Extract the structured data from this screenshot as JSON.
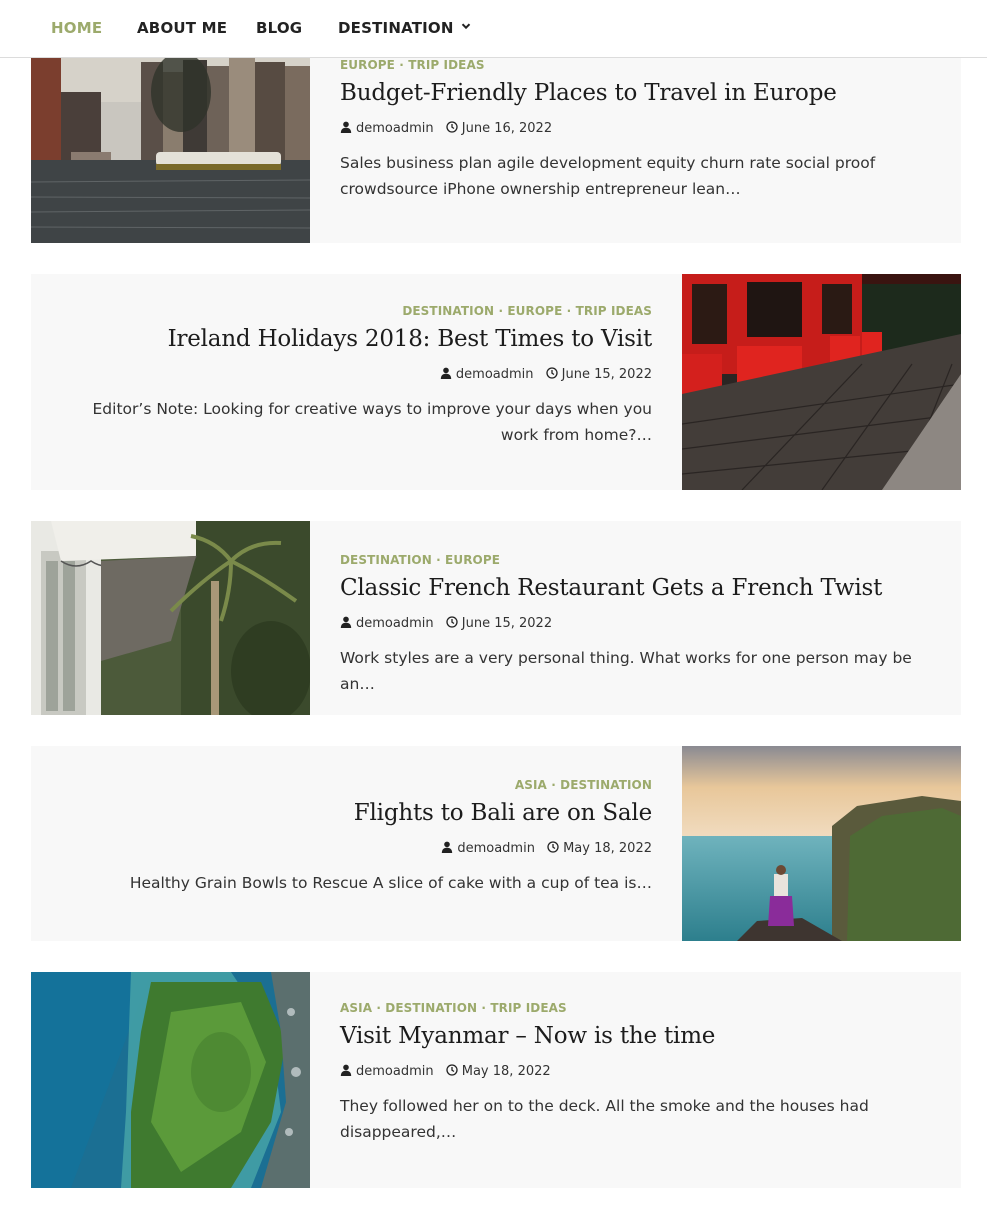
{
  "nav": {
    "items": [
      {
        "label": "HOME",
        "active": true
      },
      {
        "label": "ABOUT ME",
        "active": false
      },
      {
        "label": "BLOG",
        "active": false
      },
      {
        "label": "DESTINATION",
        "active": false,
        "has_dropdown": true
      }
    ],
    "active_color": "#9caa6c"
  },
  "posts": [
    {
      "categories": "EUROPE · TRIP IDEAS",
      "title": "Budget-Friendly Places to Travel in Europe",
      "author": "demoadmin",
      "date": "June 16, 2022",
      "excerpt": "Sales business plan agile development equity churn rate social proof crowdsource iPhone ownership entrepreneur lean…",
      "image": "amsterdam-canal"
    },
    {
      "categories": "DESTINATION · EUROPE · TRIP IDEAS",
      "title": "Ireland Holidays 2018: Best Times to Visit",
      "author": "demoadmin",
      "date": "June 15, 2022",
      "excerpt": "Editor’s Note: Looking for creative ways to improve your days when you work from home?…",
      "image": "red-pub-cobblestone"
    },
    {
      "categories": "DESTINATION · EUROPE",
      "title": "Classic French Restaurant Gets a French Twist",
      "author": "demoadmin",
      "date": "June 15, 2022",
      "excerpt": "Work styles are a very personal thing. What works for one person may be an…",
      "image": "restaurant-awning-palm"
    },
    {
      "categories": "ASIA · DESTINATION",
      "title": "Flights to Bali are on Sale",
      "author": "demoadmin",
      "date": "May 18, 2022",
      "excerpt": "Healthy Grain Bowls to Rescue A slice of cake with a cup of tea is…",
      "image": "bali-cliff-sea"
    },
    {
      "categories": "ASIA · DESTINATION · TRIP IDEAS",
      "title": "Visit Myanmar – Now is the time",
      "author": "demoadmin",
      "date": "May 18, 2022",
      "excerpt": "They followed her on to the deck. All the smoke and the houses had disappeared,…",
      "image": "aerial-island"
    }
  ]
}
